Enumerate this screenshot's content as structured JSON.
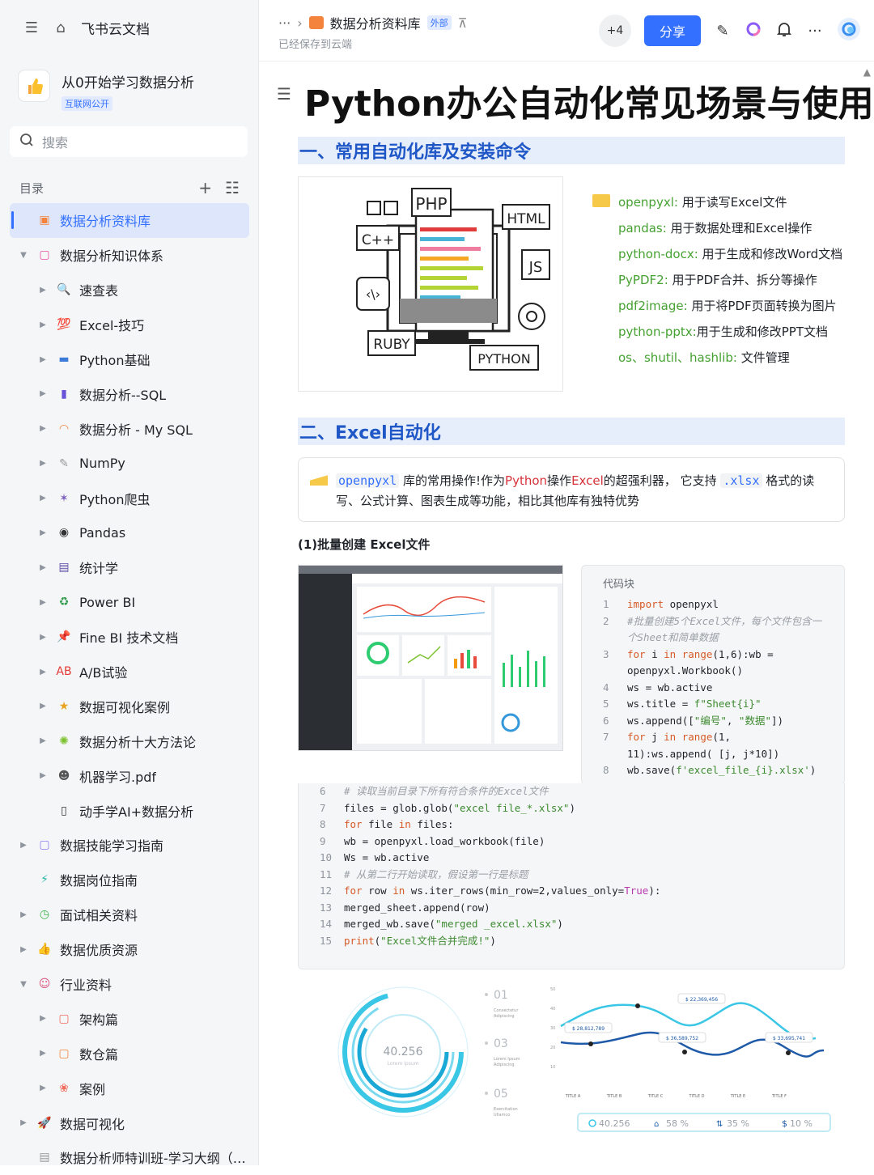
{
  "app": {
    "name": "飞书云文档"
  },
  "workspace": {
    "title": "从0开始学习数据分析",
    "badge": "互联网公开"
  },
  "search": {
    "placeholder": "搜索"
  },
  "toc": {
    "label": "目录"
  },
  "tree": [
    {
      "label": "数据分析资料库",
      "icon": "folder-icon",
      "depth": 0,
      "arrow": "",
      "selected": true,
      "color": "#f4833d",
      "glyph": "▣"
    },
    {
      "label": "数据分析知识体系",
      "icon": "book-icon",
      "depth": 0,
      "arrow": "▼",
      "color": "#e94fa1",
      "glyph": "▢"
    },
    {
      "label": "速查表",
      "icon": "magnifier-icon",
      "depth": 1,
      "arrow": "▶",
      "color": "#3370ff",
      "glyph": "🔍"
    },
    {
      "label": "Excel-技巧",
      "icon": "hundred-icon",
      "depth": 1,
      "arrow": "▶",
      "color": "#e53935",
      "glyph": "💯"
    },
    {
      "label": "Python基础",
      "icon": "monitor-icon",
      "depth": 1,
      "arrow": "▶",
      "color": "#3d7bd9",
      "glyph": "▬"
    },
    {
      "label": "数据分析--SQL",
      "icon": "bar-chart-icon",
      "depth": 1,
      "arrow": "▶",
      "color": "#6a52d9",
      "glyph": "▮"
    },
    {
      "label": "数据分析 - My SQL",
      "icon": "rainbow-icon",
      "depth": 1,
      "arrow": "▶",
      "color": "#f4833d",
      "glyph": "◠"
    },
    {
      "label": "NumPy",
      "icon": "memo-icon",
      "depth": 1,
      "arrow": "▶",
      "color": "#999",
      "glyph": "✎"
    },
    {
      "label": "Python爬虫",
      "icon": "spider-icon",
      "depth": 1,
      "arrow": "▶",
      "color": "#7a5fbf",
      "glyph": "✶"
    },
    {
      "label": "Pandas",
      "icon": "panda-icon",
      "depth": 1,
      "arrow": "▶",
      "color": "#333",
      "glyph": "◉"
    },
    {
      "label": "统计学",
      "icon": "floppy-icon",
      "depth": 1,
      "arrow": "▶",
      "color": "#5c4ba6",
      "glyph": "▤"
    },
    {
      "label": "Power BI",
      "icon": "recycle-icon",
      "depth": 1,
      "arrow": "▶",
      "color": "#2e9b4c",
      "glyph": "♻"
    },
    {
      "label": "Fine BI 技术文档",
      "icon": "pin-icon",
      "depth": 1,
      "arrow": "▶",
      "color": "#e53935",
      "glyph": "📌"
    },
    {
      "label": "A/B试验",
      "icon": "ab-icon",
      "depth": 1,
      "arrow": "▶",
      "color": "#e53935",
      "glyph": "AB"
    },
    {
      "label": "数据可视化案例",
      "icon": "medal-icon",
      "depth": 1,
      "arrow": "▶",
      "color": "#e8a421",
      "glyph": "★"
    },
    {
      "label": "数据分析十大方法论",
      "icon": "sparkle-icon",
      "depth": 1,
      "arrow": "▶",
      "color": "#7cc22e",
      "glyph": "✺"
    },
    {
      "label": "机器学习.pdf",
      "icon": "robot-icon",
      "depth": 1,
      "arrow": "▶",
      "color": "#555",
      "glyph": "☻"
    },
    {
      "label": "动手学AI+数据分析",
      "icon": "traffic-light-icon",
      "depth": 1,
      "arrow": "",
      "color": "#333",
      "glyph": "▯"
    },
    {
      "label": "数据技能学习指南",
      "icon": "doc-purple-icon",
      "depth": 0,
      "arrow": "▶",
      "color": "#8b7ef0",
      "glyph": "▢"
    },
    {
      "label": "数据岗位指南",
      "icon": "bolt-icon",
      "depth": 0,
      "arrow": "",
      "color": "#2bb5a6",
      "glyph": "⚡"
    },
    {
      "label": "面试相关资料",
      "icon": "clock-icon",
      "depth": 0,
      "arrow": "▶",
      "color": "#38b24a",
      "glyph": "◷"
    },
    {
      "label": "数据优质资源",
      "icon": "thumbs-up-icon",
      "depth": 0,
      "arrow": "▶",
      "color": "#f4a63d",
      "glyph": "👍"
    },
    {
      "label": "行业资料",
      "icon": "ghost-icon",
      "depth": 0,
      "arrow": "▼",
      "color": "#d94f7a",
      "glyph": "☺"
    },
    {
      "label": "架构篇",
      "icon": "doc-red-icon",
      "depth": 1,
      "arrow": "▶",
      "color": "#f26b5b",
      "glyph": "▢"
    },
    {
      "label": "数仓篇",
      "icon": "doc-orange-icon",
      "depth": 1,
      "arrow": "▶",
      "color": "#f4833d",
      "glyph": "▢"
    },
    {
      "label": "案例",
      "icon": "flower-icon",
      "depth": 1,
      "arrow": "▶",
      "color": "#f26b5b",
      "glyph": "❀"
    },
    {
      "label": "数据可视化",
      "icon": "rocket-icon",
      "depth": 0,
      "arrow": "▶",
      "color": "#e53935",
      "glyph": "🚀"
    },
    {
      "label": "数据分析师特训班-学习大纲（…",
      "icon": "page-icon",
      "depth": 0,
      "arrow": "",
      "color": "#999",
      "glyph": "▤"
    }
  ],
  "header": {
    "breadcrumb": "数据分析资料库",
    "tag": "外部",
    "saved": "已经保存到云端",
    "collaborators": "+4",
    "share": "分享"
  },
  "doc": {
    "title": "Python办公自动化常见场景与使用",
    "h2_1": "一、常用自动化库及安装命令",
    "h2_2": "二、Excel自动化",
    "libs": [
      {
        "name": "openpyxl:",
        "desc": " 用于读写Excel文件"
      },
      {
        "name": "pandas:",
        "desc": " 用于数据处理和Excel操作"
      },
      {
        "name": "python-docx:",
        "desc": " 用于生成和修改Word文档"
      },
      {
        "name": "PyPDF2:",
        "desc": " 用于PDF合并、拆分等操作"
      },
      {
        "name": "pdf2image:",
        "desc": " 用于将PDF页面转换为图片"
      },
      {
        "name": "python-pptx:",
        "desc": "用于生成和修改PPT文档"
      },
      {
        "name": "os、shutil、hashlib:",
        "desc": " 文件管理"
      }
    ],
    "callout": {
      "code1": "openpyxl",
      "t1": " 库的常用操作!作为",
      "r1": "Python",
      "t2": "操作",
      "r2": "Excel",
      "t3": "的超强利器， 它支持 ",
      "code2": ".xlsx",
      "t4": " 格式的读写、公式计算、图表生成等功能，相比其他库有独特优势"
    },
    "sub1": "(1)批量创建 Excel文件",
    "code_label": "代码块"
  },
  "illustration": {
    "labels": [
      "PHP",
      "HTML",
      "C++",
      "JS",
      "RUBY",
      "PYTHON"
    ]
  },
  "bottom_figure": {
    "ring_value": "40.256",
    "ring_sub": "Lorem ipsum",
    "steps": [
      {
        "n": "01",
        "t1": "Consectetur",
        "t2": "Adipiscing"
      },
      {
        "n": "03",
        "t1": "Lorem Ipsum",
        "t2": "Adipiscing"
      },
      {
        "n": "05",
        "t1": "Exercitation",
        "t2": "Ullamco"
      }
    ],
    "yticks": [
      "50",
      "40",
      "30",
      "20",
      "10"
    ],
    "xticks": [
      "TITLE A",
      "TITLE B",
      "TITLE C",
      "TITLE D",
      "TITLE E",
      "TITLE F"
    ],
    "callouts": [
      "$ 28,812,789",
      "$ 22,369,456",
      "$ 36,589,752",
      "$ 33,695,741"
    ],
    "stats": [
      "40.256",
      "58 %",
      "35 %",
      "10 %"
    ]
  }
}
